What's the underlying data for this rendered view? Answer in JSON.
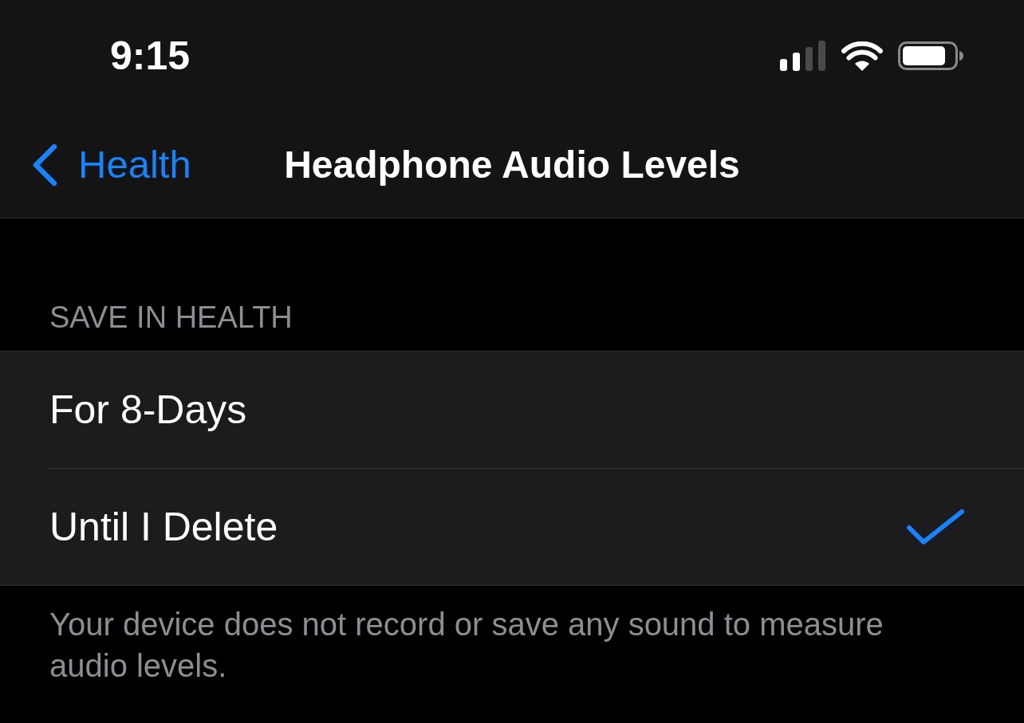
{
  "status_bar": {
    "time": "9:15"
  },
  "nav_bar": {
    "back_label": "Health",
    "title": "Headphone Audio Levels"
  },
  "section": {
    "header": "SAVE IN HEALTH",
    "options": [
      {
        "label": "For 8-Days",
        "selected": false
      },
      {
        "label": "Until I Delete",
        "selected": true
      }
    ],
    "footer": "Your device does not record or save any sound to measure audio levels."
  }
}
